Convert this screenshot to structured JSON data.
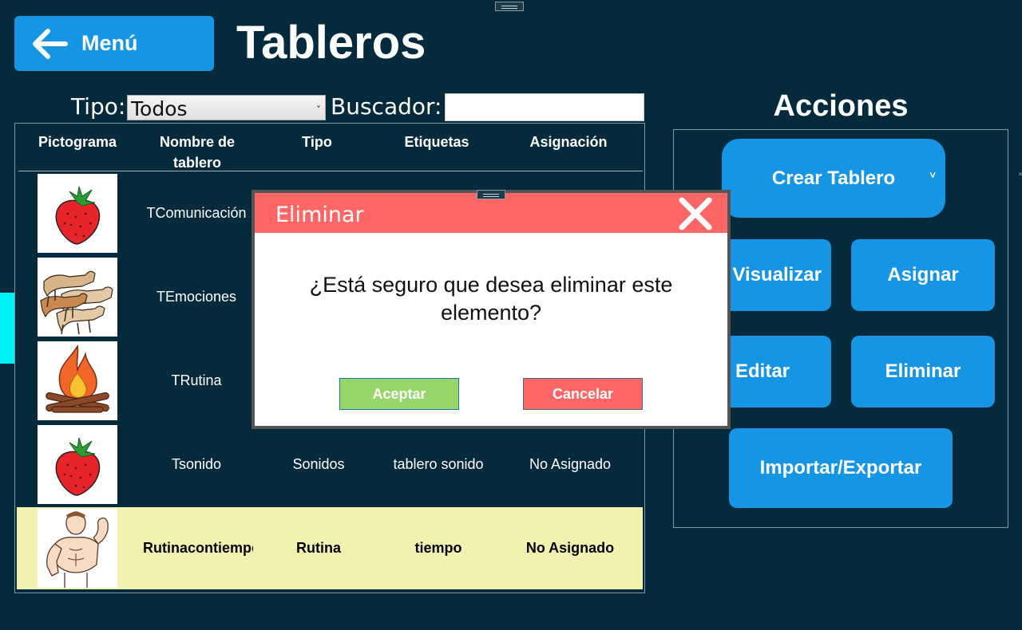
{
  "window": {
    "title": "Tableros"
  },
  "header": {
    "menu_label": "Menú",
    "title": "Tableros"
  },
  "filters": {
    "tipo_label": "Tipo:",
    "tipo_value": "Todos",
    "buscador_label": "Buscador:",
    "search_value": ""
  },
  "table": {
    "headers": [
      "Pictograma",
      "Nombre de tablero",
      "Tipo",
      "Etiquetas",
      "Asignación"
    ],
    "rows": [
      {
        "picto": "strawberry-icon",
        "nombre": "TComunicación",
        "tipo": "",
        "etiquetas": "",
        "asignacion": ""
      },
      {
        "picto": "dogs-icon",
        "nombre": "TEmociones",
        "tipo": "",
        "etiquetas": "",
        "asignacion": ""
      },
      {
        "picto": "campfire-icon",
        "nombre": "TRutina",
        "tipo": "",
        "etiquetas": "",
        "asignacion": ""
      },
      {
        "picto": "strawberry-icon",
        "nombre": "Tsonido",
        "tipo": "Sonidos",
        "etiquetas": "tablero sonido",
        "asignacion": "No Asignado"
      },
      {
        "picto": "muscle-man-icon",
        "nombre": "Rutinacontiempo",
        "tipo": "Rutina",
        "etiquetas": "tiempo",
        "asignacion": "No Asignado",
        "selected": true
      }
    ]
  },
  "actions": {
    "title": "Acciones",
    "crear": "Crear Tablero",
    "visualizar": "Visualizar",
    "asignar": "Asignar",
    "editar": "Editar",
    "eliminar": "Eliminar",
    "importar": "Importar/Exportar"
  },
  "dialog": {
    "title": "Eliminar",
    "message_line1": "¿Está seguro que desea eliminar este",
    "message_line2": "elemento?",
    "accept": "Aceptar",
    "cancel": "Cancelar"
  },
  "colors": {
    "background": "#052a3b",
    "accent": "#1595e3",
    "danger": "#ff6666",
    "ok": "#98d56a",
    "selected_row": "#f2f2b0",
    "side_tab": "#00f3f6"
  }
}
